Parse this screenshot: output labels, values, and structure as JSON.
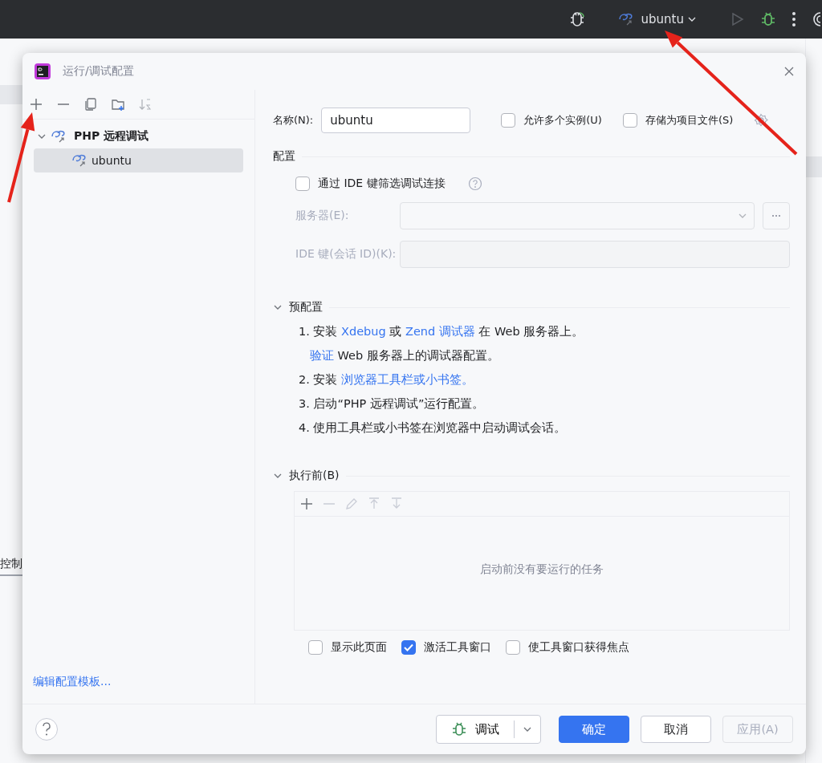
{
  "top_bar": {
    "run_config": {
      "label": "ubuntu"
    }
  },
  "background": {
    "tab": "控制"
  },
  "dialog": {
    "title": "运行/调试配置",
    "tree": [
      {
        "label": "PHP 远程调试",
        "expanded": true,
        "children": [
          {
            "label": "ubuntu",
            "selected": true
          }
        ]
      }
    ],
    "edit_templates_link": "编辑配置模板...",
    "name_field": {
      "label": "名称(N):",
      "value": "ubuntu"
    },
    "header_options": [
      {
        "label": "允许多个实例(U)",
        "checked": false
      },
      {
        "label": "存储为项目文件(S)",
        "checked": false
      }
    ],
    "config_section": {
      "title": "配置",
      "filter_option": {
        "label": "通过 IDE 键筛选调试连接",
        "checked": false
      },
      "server": {
        "label": "服务器(E):",
        "disabled": true
      },
      "ide_key": {
        "label": "IDE 键(会话 ID)(K):",
        "disabled": true
      }
    },
    "preconfig": {
      "title": "预配置",
      "expanded": true,
      "steps": [
        [
          {
            "text": "1. 安装 "
          },
          {
            "text": "Xdebug",
            "link": true
          },
          {
            "text": " 或 "
          },
          {
            "text": "Zend 调试器",
            "link": true
          },
          {
            "text": " 在 Web 服务器上。"
          }
        ],
        [
          {
            "text": "验证",
            "link": true
          },
          {
            "text": " Web 服务器上的调试器配置。"
          }
        ],
        [
          {
            "text": "2. 安装 "
          },
          {
            "text": "浏览器工具栏或小书签。",
            "link": true
          }
        ],
        [
          {
            "text": "3. 启动“PHP 远程调试”运行配置。"
          }
        ],
        [
          {
            "text": "4. 使用工具栏或小书签在浏览器中启动调试会话。"
          }
        ]
      ]
    },
    "before_launch": {
      "title": "执行前(B)",
      "expanded": true,
      "empty_text": "启动前没有要运行的任务",
      "options": [
        {
          "label": "显示此页面",
          "checked": false
        },
        {
          "label": "激活工具窗口",
          "checked": true
        },
        {
          "label": "使工具窗口获得焦点",
          "checked": false
        }
      ]
    },
    "buttons": [
      {
        "kind": "split",
        "label": "调试"
      },
      {
        "kind": "primary",
        "label": "确定"
      },
      {
        "kind": "normal",
        "label": "取消"
      },
      {
        "kind": "normal",
        "label": "应用(A)",
        "disabled": true
      }
    ]
  },
  "annotations": [
    {
      "kind": "arrow"
    },
    {
      "kind": "arrow"
    }
  ]
}
